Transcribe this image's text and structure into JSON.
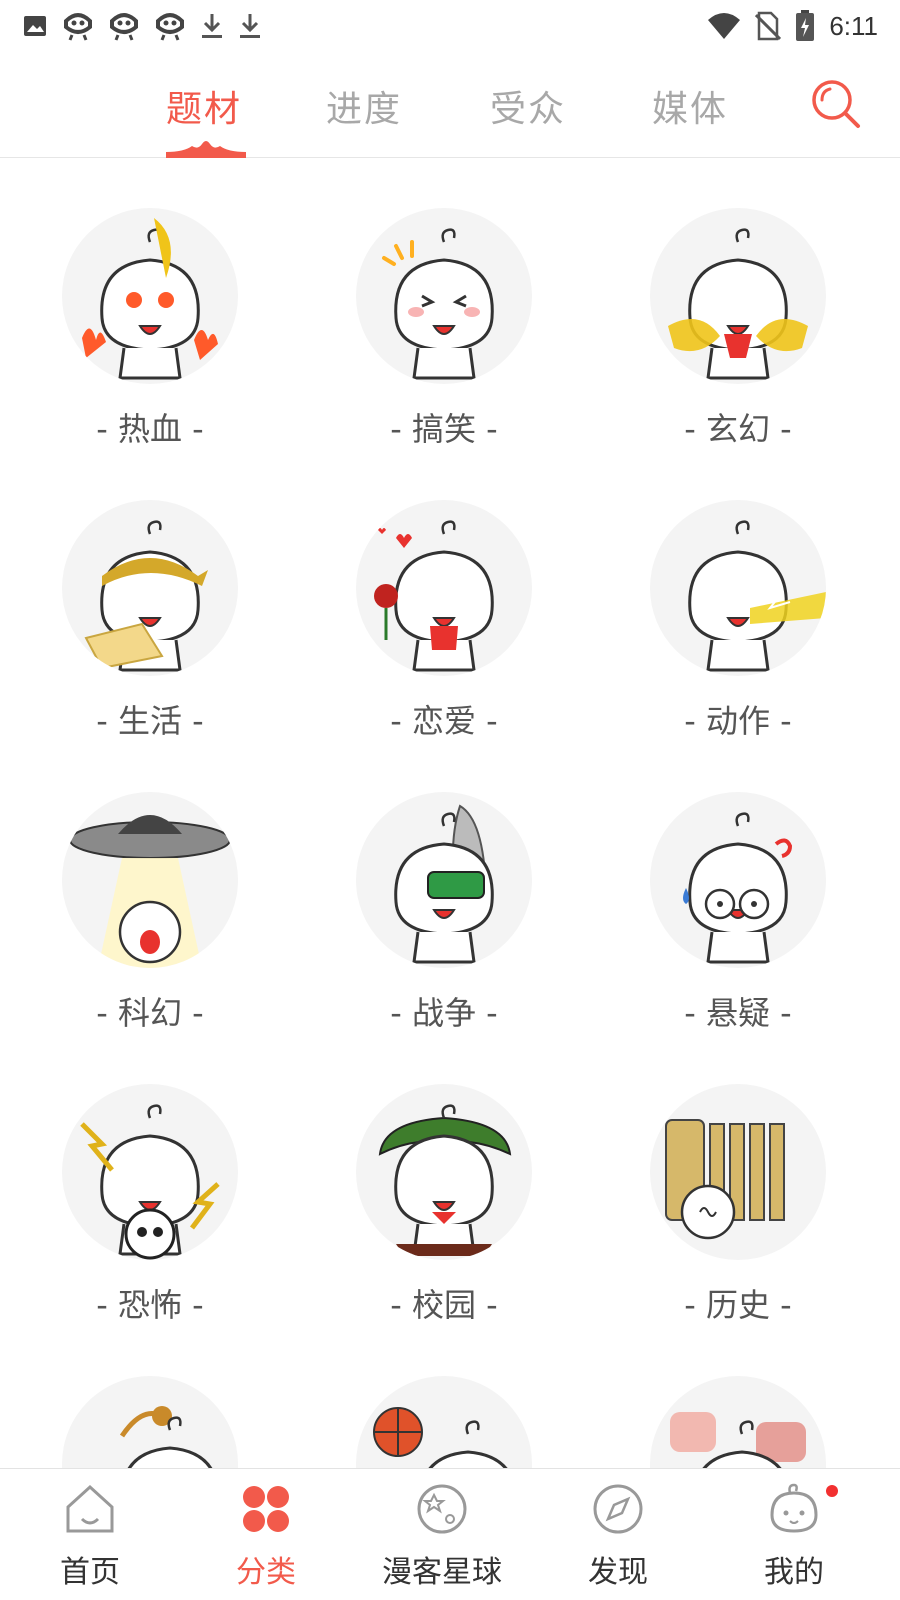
{
  "status_bar": {
    "time": "6:11",
    "left_icons": [
      "image-icon",
      "bug-icon",
      "bug-icon",
      "bug-icon",
      "download-icon",
      "download-icon"
    ],
    "right_icons": [
      "wifi-icon",
      "no-sim-icon",
      "battery-icon"
    ]
  },
  "tabs": [
    {
      "label": "题材",
      "active": true
    },
    {
      "label": "进度",
      "active": false
    },
    {
      "label": "受众",
      "active": false
    },
    {
      "label": "媒体",
      "active": false
    }
  ],
  "search": {
    "icon": "search-icon"
  },
  "categories": [
    {
      "label": "- 热血 -",
      "accent": "#ff5a2a"
    },
    {
      "label": "- 搞笑 -",
      "accent": "#ffb020"
    },
    {
      "label": "- 玄幻 -",
      "accent": "#f0c419"
    },
    {
      "label": "- 生活 -",
      "accent": "#d4a82a"
    },
    {
      "label": "- 恋爱 -",
      "accent": "#e8322e"
    },
    {
      "label": "- 动作 -",
      "accent": "#f0d21e"
    },
    {
      "label": "- 科幻 -",
      "accent": "#8a8a8a"
    },
    {
      "label": "- 战争 -",
      "accent": "#2f9a45"
    },
    {
      "label": "- 悬疑 -",
      "accent": "#3a7bd5"
    },
    {
      "label": "- 恐怖 -",
      "accent": "#e0b21a"
    },
    {
      "label": "- 校园 -",
      "accent": "#3e7d2c"
    },
    {
      "label": "- 历史 -",
      "accent": "#d6b86a"
    },
    {
      "label": "",
      "accent": "#c98a2a"
    },
    {
      "label": "",
      "accent": "#e0522a"
    },
    {
      "label": "",
      "accent": "#f2b8b0"
    }
  ],
  "bottom_nav": [
    {
      "label": "首页",
      "icon": "home-icon",
      "active": false
    },
    {
      "label": "分类",
      "icon": "category-icon",
      "active": true
    },
    {
      "label": "漫客星球",
      "icon": "planet-icon",
      "active": false
    },
    {
      "label": "发现",
      "icon": "compass-icon",
      "active": false
    },
    {
      "label": "我的",
      "icon": "profile-icon",
      "active": false,
      "badge": true
    }
  ],
  "colors": {
    "accent": "#f25a4b",
    "inactive_tab": "#a8a8a8",
    "avatar_bg": "#f4f4f4"
  }
}
